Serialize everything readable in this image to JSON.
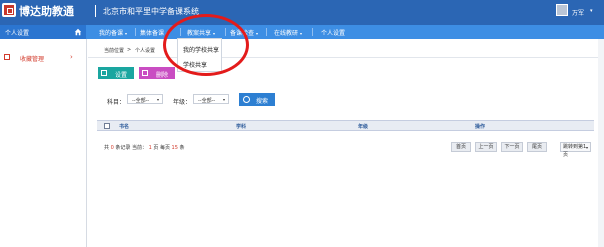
{
  "header": {
    "logo_text": "博达助教通",
    "system_title": "北京市和平里中学备课系统",
    "user_name": "万军",
    "user_caret": "▾"
  },
  "navbar": {
    "side_head_label": "个人设置",
    "items": [
      {
        "label": "我的备课",
        "caret": "▾"
      },
      {
        "label": "集体备课",
        "caret": "▾"
      },
      {
        "label": "教案共享",
        "caret": "▾"
      },
      {
        "label": "备课检查",
        "caret": "▾"
      },
      {
        "label": "在线教研",
        "caret": "▾"
      },
      {
        "label": "个人设置",
        "caret": ""
      }
    ]
  },
  "sidebar": {
    "items": [
      {
        "label": "收藏管理",
        "chevron": "›"
      }
    ]
  },
  "breadcrumb": {
    "current_label": "当前位置",
    "separator": ">",
    "page": "个人设置"
  },
  "dropdown": {
    "items": [
      "我的学校共享",
      "学校共享"
    ]
  },
  "toolbar": {
    "set_label": "设置",
    "delete_label": "删除"
  },
  "filters": {
    "subject_label": "科目：",
    "subject_value": "--全部--",
    "grade_label": "年级：",
    "grade_value": "--全部--",
    "select_caret": "▾",
    "search_label": "搜索"
  },
  "table": {
    "headers": [
      "书名",
      "学科",
      "年级",
      "操作"
    ]
  },
  "pager": {
    "text_1": "共",
    "total": "0",
    "text_2": "条记录 当前：",
    "current": "1",
    "text_3": "页 每页",
    "per_page": "15",
    "text_4": "条",
    "first": "首页",
    "prev": "上一页",
    "next": "下一页",
    "last": "尾页",
    "jump_label": "跳转到第1页",
    "jump_caret": "▾"
  },
  "colors": {
    "topbar": "#2b66b4",
    "navbar": "#3d8ee4",
    "accent_red": "#d23b2c",
    "btn_teal": "#1aa6a0",
    "btn_magenta": "#c94dc2",
    "btn_blue": "#2d7fd2"
  }
}
